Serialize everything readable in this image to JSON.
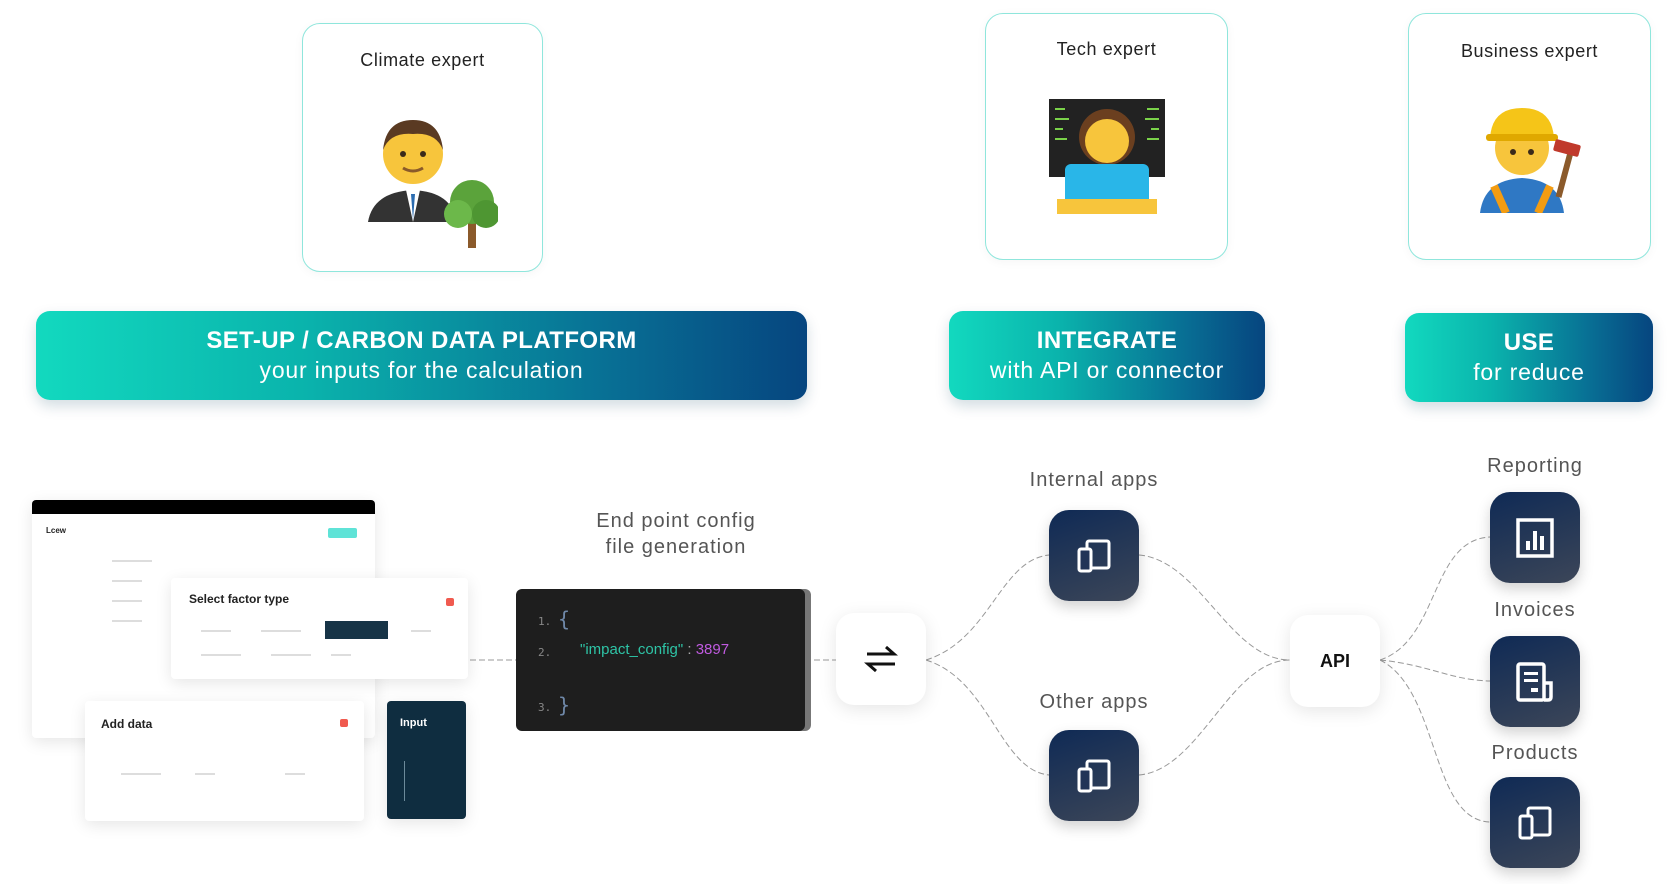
{
  "experts": [
    {
      "title": "Climate expert",
      "icon": "man-office-worker-with-tree-icon"
    },
    {
      "title": "Tech expert",
      "icon": "woman-technologist-icon"
    },
    {
      "title": "Business expert",
      "icon": "construction-worker-with-hammer-icon"
    }
  ],
  "banners": [
    {
      "title": "SET-UP / CARBON DATA PLATFORM",
      "subtitle": "your inputs for the calculation"
    },
    {
      "title": "INTEGRATE",
      "subtitle": "with API or connector"
    },
    {
      "title": "USE",
      "subtitle": "for reduce"
    }
  ],
  "mockup": {
    "logo": "Lcew",
    "select_title": "Select factor type",
    "add_title": "Add data",
    "input_title": "Input"
  },
  "config": {
    "label_line1": "End point config",
    "label_line2": "file generation",
    "lines": [
      {
        "num": "1.",
        "text": "{"
      },
      {
        "num": "2.",
        "key": "\"impact_config\"",
        "sep": " : ",
        "value": "3897"
      },
      {
        "num": "3.",
        "text": "}"
      }
    ]
  },
  "connector": {
    "icon": "swap-arrows-icon"
  },
  "apps": [
    {
      "label": "Internal apps",
      "icon": "devices-icon"
    },
    {
      "label": "Other apps",
      "icon": "devices-icon"
    }
  ],
  "api": {
    "label": "API"
  },
  "outputs": [
    {
      "label": "Reporting",
      "icon": "bar-chart-report-icon"
    },
    {
      "label": "Invoices",
      "icon": "invoice-document-icon"
    },
    {
      "label": "Products",
      "icon": "devices-icon"
    }
  ],
  "colors": {
    "teal": "#12d9bf",
    "navy": "#06457f",
    "tile": "#1a2f55",
    "json_key": "#2ec4a6",
    "json_value": "#c05be0"
  }
}
